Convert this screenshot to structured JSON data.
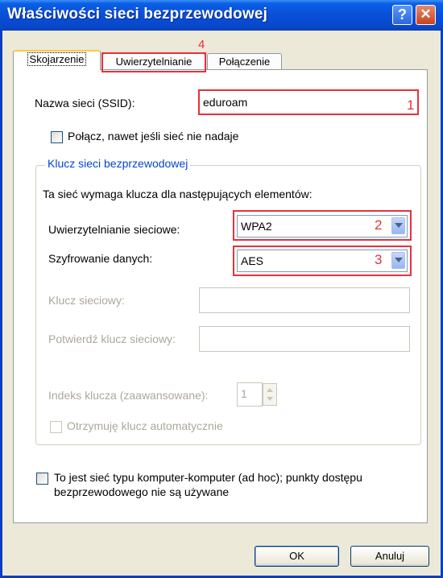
{
  "window": {
    "title": "Właściwości sieci bezprzewodowej",
    "help_label": "?",
    "close_label": "✕"
  },
  "tabs": [
    {
      "label": "Skojarzenie",
      "active": true
    },
    {
      "label": "Uwierzytelnianie",
      "active": false
    },
    {
      "label": "Połączenie",
      "active": false
    }
  ],
  "ssid": {
    "label": "Nazwa sieci (SSID):",
    "value": "eduroam"
  },
  "connect_hidden": {
    "label": "Połącz, nawet jeśli sieć nie nadaje",
    "checked": false
  },
  "key_group": {
    "title": "Klucz sieci bezprzewodowej",
    "description": "Ta sieć wymaga klucza dla następujących elementów:",
    "auth": {
      "label": "Uwierzytelnianie sieciowe:",
      "value": "WPA2"
    },
    "encryption": {
      "label": "Szyfrowanie danych:",
      "value": "AES"
    },
    "network_key": {
      "label": "Klucz sieciowy:",
      "value": ""
    },
    "confirm_key": {
      "label": "Potwierdź klucz sieciowy:",
      "value": ""
    },
    "key_index": {
      "label": "Indeks klucza (zaawansowane):",
      "value": "1"
    },
    "auto_key": {
      "label": "Otrzymuję klucz automatycznie",
      "checked": false
    }
  },
  "adhoc": {
    "line1": "To jest sieć typu komputer-komputer (ad hoc); punkty dostępu",
    "line2": "bezprzewodowego nie są używane",
    "checked": false
  },
  "annotations": {
    "ssid_mark": "1",
    "auth_mark": "2",
    "encryption_mark": "3",
    "tab_mark": "4",
    "color": "#e8303c"
  },
  "buttons": {
    "ok": "OK",
    "cancel": "Anuluj"
  },
  "colors": {
    "titlebar": "#0a4fd8",
    "dialog_bg": "#ece9d8",
    "group_title": "#0046d5"
  }
}
